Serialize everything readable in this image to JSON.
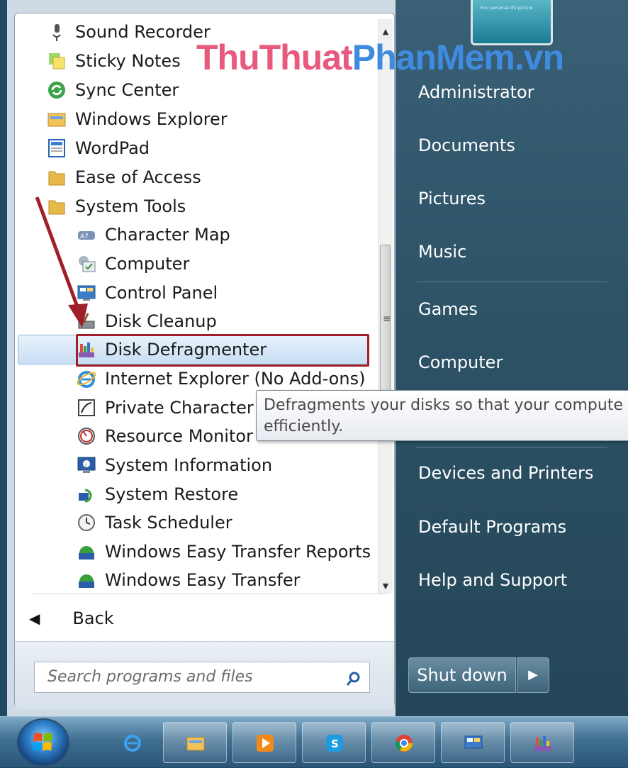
{
  "watermark": {
    "part1": "ThuThuat",
    "part2": "PhanMem.vn"
  },
  "programs": {
    "items": [
      {
        "label": "Sound Recorder",
        "icon": "microphone-icon"
      },
      {
        "label": "Sticky Notes",
        "icon": "sticky-notes-icon"
      },
      {
        "label": "Sync Center",
        "icon": "sync-center-icon"
      },
      {
        "label": "Windows Explorer",
        "icon": "windows-explorer-icon"
      },
      {
        "label": "WordPad",
        "icon": "wordpad-icon"
      },
      {
        "label": "Ease of Access",
        "icon": "folder-icon"
      },
      {
        "label": "System Tools",
        "icon": "folder-icon"
      },
      {
        "label": "Character Map",
        "icon": "character-map-icon"
      },
      {
        "label": "Computer",
        "icon": "computer-icon"
      },
      {
        "label": "Control Panel",
        "icon": "control-panel-icon"
      },
      {
        "label": "Disk Cleanup",
        "icon": "disk-cleanup-icon"
      },
      {
        "label": "Disk Defragmenter",
        "icon": "disk-defragmenter-icon"
      },
      {
        "label": "Internet Explorer (No Add-ons)",
        "icon": "internet-explorer-icon"
      },
      {
        "label": "Private Character Editor",
        "icon": "private-character-editor-icon"
      },
      {
        "label": "Resource Monitor",
        "icon": "resource-monitor-icon"
      },
      {
        "label": "System Information",
        "icon": "system-information-icon"
      },
      {
        "label": "System Restore",
        "icon": "system-restore-icon"
      },
      {
        "label": "Task Scheduler",
        "icon": "task-scheduler-icon"
      },
      {
        "label": "Windows Easy Transfer Reports",
        "icon": "easy-transfer-icon"
      },
      {
        "label": "Windows Easy Transfer",
        "icon": "easy-transfer-icon"
      }
    ],
    "selected": "Disk Defragmenter"
  },
  "back_label": "Back",
  "search": {
    "placeholder": "Search programs and files"
  },
  "right": {
    "user_tile_text": "Your personal life picture",
    "items": [
      "Administrator",
      "Documents",
      "Pictures",
      "Music",
      "Games",
      "Computer",
      "Devices and Printers",
      "Default Programs",
      "Help and Support"
    ]
  },
  "shutdown_label": "Shut down",
  "tooltip": {
    "line1": "Defragments your disks so that your compute",
    "line2": "efficiently."
  },
  "taskbar": {
    "buttons": [
      "internet-explorer-icon",
      "file-explorer-icon",
      "media-player-icon",
      "skype-icon",
      "chrome-icon",
      "control-panel-icon",
      "disk-defragmenter-icon"
    ]
  },
  "colors": {
    "accent_red": "#a0202a",
    "watermark_pink": "#e8597e",
    "watermark_blue": "#3e8be0"
  }
}
